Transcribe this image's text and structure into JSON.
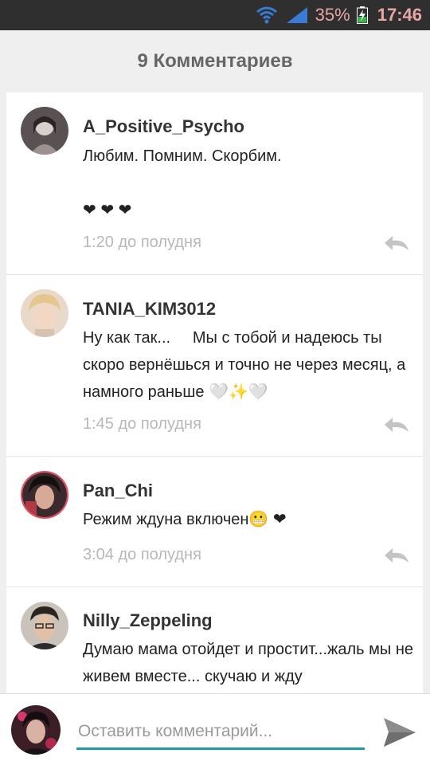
{
  "status_bar": {
    "battery_percent": "35%",
    "time": "17:46",
    "wifi_icon": "wifi-icon",
    "signal_icon": "signal-icon",
    "battery_icon": "battery-charging-icon"
  },
  "header": {
    "title": "9 Комментариев"
  },
  "comments": [
    {
      "author": "A_Positive_Psycho",
      "text": "Любим. Помним. Скорбим.\n\n❤ ❤ ❤",
      "time": "1:20 до полудня"
    },
    {
      "author": "TANIA_KIM3012",
      "text": "Ну как так...     Мы с тобой и надеюсь ты скоро вернёшься и точно не через месяц, а намного раньше 🤍✨🤍",
      "time": "1:45 до полудня"
    },
    {
      "author": "Pan_Chi",
      "text": "Режим ждуна включен😬 ❤",
      "time": "3:04 до полудня"
    },
    {
      "author": "Nilly_Zeppeling",
      "text": "Думаю мама отойдет и простит...жаль мы не живем вместе... скучаю и жду",
      "time": ""
    }
  ],
  "composer": {
    "placeholder": "Оставить комментарий...",
    "value": ""
  },
  "colors": {
    "accent": "#1e9aa8",
    "status_text": "#e8a6a6",
    "status_bg": "#2f2f2f"
  }
}
